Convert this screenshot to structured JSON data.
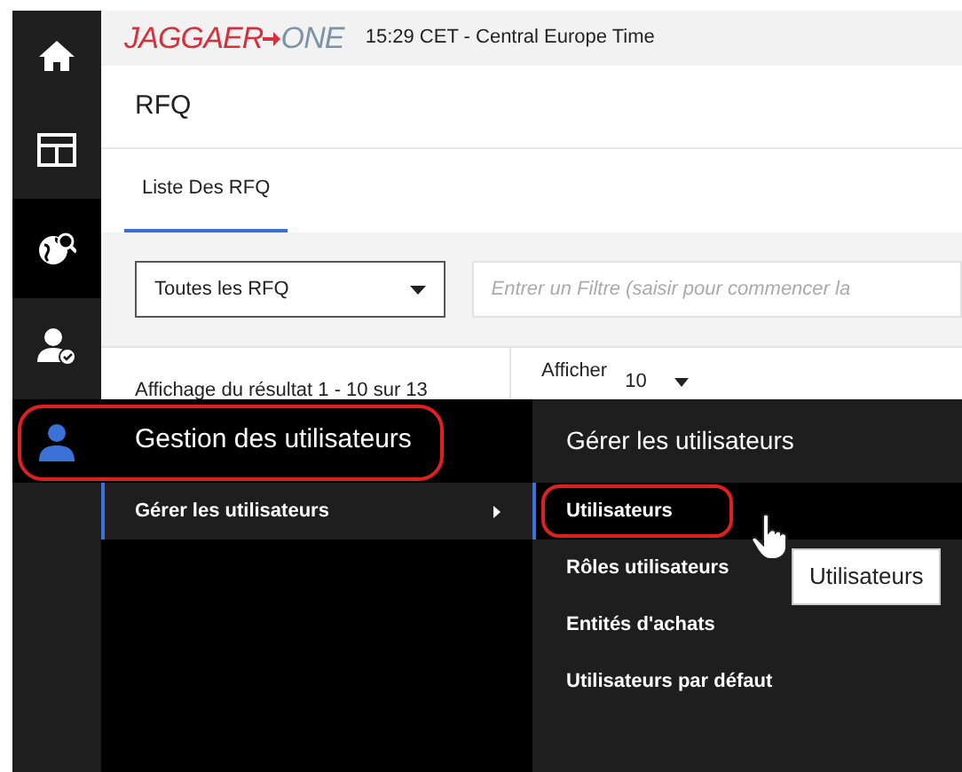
{
  "sidebar": {
    "items": [
      {
        "kind": "home",
        "selected": false
      },
      {
        "kind": "layout",
        "selected": false
      },
      {
        "kind": "globe",
        "selected": true
      },
      {
        "kind": "user-check",
        "selected": false
      }
    ]
  },
  "header": {
    "logo_left": "JAGGAER",
    "logo_right": "ONE",
    "time": "15:29 CET - Central Europe Time"
  },
  "page_title": "RFQ",
  "tabs": [
    {
      "label": "Liste Des RFQ",
      "selected": true
    }
  ],
  "filters": {
    "select_value": "Toutes les RFQ",
    "placeholder": "Entrer un Filtre (saisir pour commencer la"
  },
  "results": {
    "summary": "Affichage du résultat 1 - 10 sur 13",
    "page_size_label": "Afficher",
    "page_size": "10"
  },
  "menu": {
    "title": "Gestion des utilisateurs",
    "annotated": true,
    "sections": [
      {
        "label": "Gérer les utilisateurs",
        "selected": true
      }
    ],
    "submenu": {
      "title": "Gérer les utilisateurs",
      "items": [
        {
          "label": "Utilisateurs",
          "selected": true,
          "annotated": true
        },
        {
          "label": "Rôles utilisateurs",
          "selected": false,
          "annotated": false
        },
        {
          "label": "Entités d'achats",
          "selected": false,
          "annotated": false
        },
        {
          "label": "Utilisateurs par défaut",
          "selected": false,
          "annotated": false
        }
      ]
    }
  },
  "tooltip": "Utilisateurs"
}
